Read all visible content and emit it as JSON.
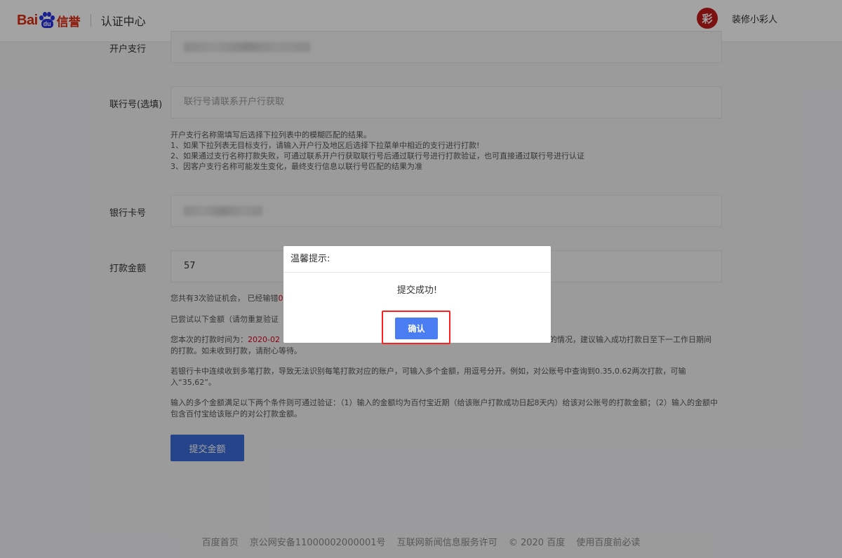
{
  "header": {
    "logo_bai": "Bai",
    "logo_du": "du",
    "logo_xin": "信誉",
    "center_title": "认证中心",
    "avatar_char": "彩",
    "username": "装修小彩人"
  },
  "form": {
    "branch_label": "开户支行",
    "bank_code_label": "联行号(选填)",
    "bank_code_placeholder": "联行号请联系开户行获取",
    "note_lines": [
      "开户支行名称需填写后选择下拉列表中的模糊匹配的结果。",
      "1、如果下拉列表无目标支行，请输入开户行及地区后选择下拉菜单中相近的支行进行打款!",
      "2、如果通过支行名称打款失败，可通过联系开户行获取联行号后通过联行号进行打款验证，也可直接通过联行号进行认证",
      "3、因客户支行名称可能发生变化，最终支行信息以联行号匹配的结果为准"
    ],
    "card_label": "银行卡号",
    "amount_label": "打款金额",
    "amount_value": "57",
    "chance_text": "您共有3次验证机会， 已经输错",
    "chance_suffix": "0",
    "tried_text": "已尝试以下金额（请勿重复验证",
    "time_prefix": "您本次的打款时间为：",
    "time_value": "2020-02",
    "time_suffix_line1": "的情况，建议输入成功打款日至下一工作日期间",
    "time_line2": "的打款。如未收到打款，请耐心等待。",
    "multi_text": "若银行卡中连续收到多笔打款，导致无法识别每笔打款对应的账户，可输入多个金额，用逗号分开。例如，对公账号中查询到0.35,0.62两次打款，可输入“35,62”。",
    "condition_text": "输入的多个金额满足以下两个条件则可通过验证：（1）输入的金额均为百付宝近期（给该账户打款成功日起8天内）给该对公账号的打款金额；（2）输入的金额中包含百付宝给该账户的对公打款金额。",
    "submit_label": "提交金额"
  },
  "footer": {
    "links": [
      "百度首页",
      "京公网安备11000002000001号",
      "互联网新闻信息服务许可",
      "© 2020 百度",
      "使用百度前必读"
    ]
  },
  "modal": {
    "title": "温馨提示:",
    "message": "提交成功!",
    "confirm_label": "确认"
  },
  "colors": {
    "brand_red": "#de2910",
    "brand_blue": "#2932e1",
    "primary_button": "#3b6bd6",
    "highlight_border": "#ff1f1f"
  }
}
